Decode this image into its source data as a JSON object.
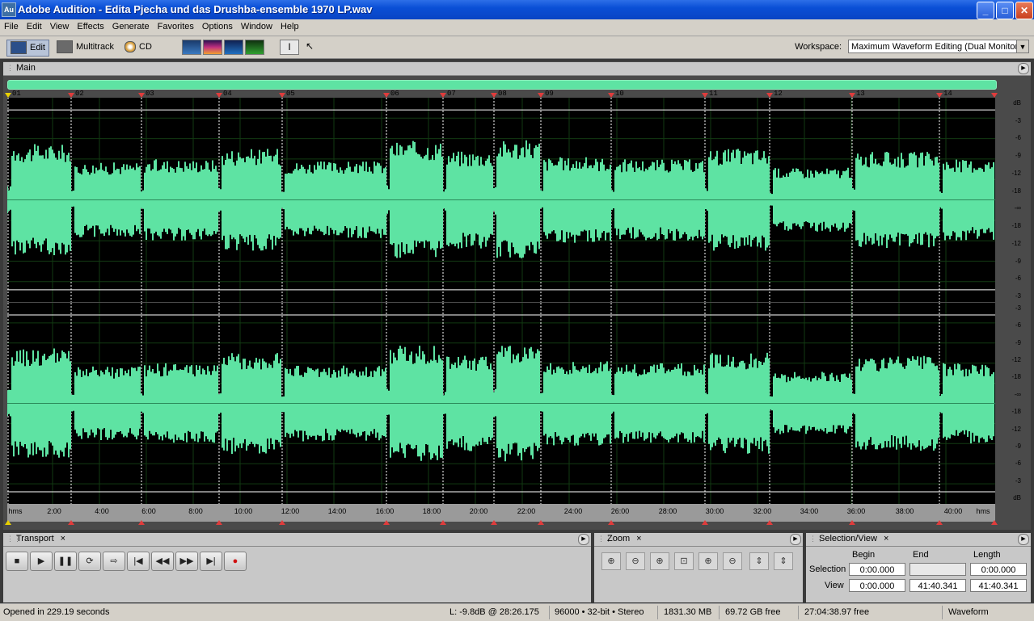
{
  "window": {
    "title": "Adobe Audition - Edita Pjecha und das Drushba-ensemble 1970 LP.wav",
    "app_icon": "Au",
    "buttons": {
      "minimize": "_",
      "maximize": "□",
      "close": "✕"
    }
  },
  "menu": [
    "File",
    "Edit",
    "View",
    "Effects",
    "Generate",
    "Favorites",
    "Options",
    "Window",
    "Help"
  ],
  "toolbar": {
    "modes": [
      {
        "label": "Edit",
        "icon": "waveform-edit-icon"
      },
      {
        "label": "Multitrack",
        "icon": "multitrack-icon"
      },
      {
        "label": "CD",
        "icon": "cd-icon"
      }
    ],
    "workspace_label": "Workspace:",
    "workspace_value": "Maximum Waveform Editing (Dual Monitor)",
    "workspace_arrow": "▼"
  },
  "main_panel": {
    "title": "Main",
    "markers": [
      "01",
      "02",
      "03",
      "04",
      "05",
      "06",
      "07",
      "08",
      "09",
      "10",
      "11",
      "12",
      "13",
      "14"
    ],
    "db_scale_top": [
      "dB",
      "-3",
      "-6",
      "-9",
      "-12",
      "-18",
      "-∞",
      "-18",
      "-12",
      "-9",
      "-6",
      "-3"
    ],
    "db_scale_bottom": [
      "-3",
      "-6",
      "-9",
      "-12",
      "-18",
      "-∞",
      "-18",
      "-12",
      "-9",
      "-6",
      "-3",
      "dB"
    ],
    "time_labels": [
      "hms",
      "2:00",
      "4:00",
      "6:00",
      "8:00",
      "10:00",
      "12:00",
      "14:00",
      "16:00",
      "18:00",
      "20:00",
      "22:00",
      "24:00",
      "26:00",
      "28:00",
      "30:00",
      "32:00",
      "34:00",
      "36:00",
      "38:00",
      "40:00",
      "hms"
    ],
    "waveform_color": "#5ee3a3"
  },
  "transport": {
    "title": "Transport",
    "close": "×",
    "buttons": [
      "■",
      "▶",
      "❚❚",
      "⟳",
      "⇨",
      "|◀",
      "◀◀",
      "▶▶",
      "▶|",
      "●"
    ]
  },
  "zoom": {
    "title": "Zoom",
    "close": "×",
    "buttons": [
      "⊕",
      "⊖",
      "⊕",
      "⊡",
      "⊕",
      "⊖",
      "⇕",
      "⇕"
    ]
  },
  "selection_view": {
    "title": "Selection/View",
    "close": "×",
    "col_begin": "Begin",
    "col_end": "End",
    "col_length": "Length",
    "row_selection": "Selection",
    "row_view": "View",
    "selection_begin": "0:00.000",
    "selection_end": "",
    "selection_length": "0:00.000",
    "view_begin": "0:00.000",
    "view_end": "41:40.341",
    "view_length": "41:40.341"
  },
  "status": {
    "message": "Opened in 229.19 seconds",
    "level": "L: -9.8dB @  28:26.175",
    "format": "96000 • 32-bit • Stereo",
    "size": "1831.30 MB",
    "free_disk": "69.72 GB free",
    "free_time": "27:04:38.97 free",
    "view": "Waveform"
  }
}
